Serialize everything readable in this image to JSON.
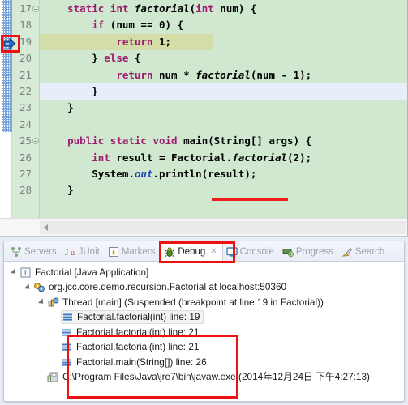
{
  "editor": {
    "bg_color": "#cfe8cc",
    "debug_line_color": "#d3dda7",
    "selected_line_color": "#e7eefa",
    "annotation_color": "#ee1c1c",
    "breakpoint_icon": "debug-current-instruction-arrow-icon",
    "lines": [
      {
        "number": "17",
        "folding": true,
        "highlight": "none",
        "text": "    static int factorial(int num) {"
      },
      {
        "number": "18",
        "folding": false,
        "highlight": "none",
        "text": "        if (num == 0) {"
      },
      {
        "number": "19",
        "folding": false,
        "highlight": "debug",
        "text": "            return 1;"
      },
      {
        "number": "20",
        "folding": false,
        "highlight": "none",
        "text": "        } else {"
      },
      {
        "number": "21",
        "folding": false,
        "highlight": "none",
        "text": "            return num * factorial(num - 1);"
      },
      {
        "number": "22",
        "folding": false,
        "highlight": "select",
        "text": "        }"
      },
      {
        "number": "23",
        "folding": false,
        "highlight": "none",
        "text": "    }"
      },
      {
        "number": "24",
        "folding": false,
        "highlight": "none",
        "text": ""
      },
      {
        "number": "25",
        "folding": true,
        "highlight": "none",
        "text": "    public static void main(String[] args) {"
      },
      {
        "number": "26",
        "folding": false,
        "highlight": "none",
        "text": "        int result = Factorial.factorial(2);"
      },
      {
        "number": "27",
        "folding": false,
        "highlight": "none",
        "text": "        System.out.println(result);"
      },
      {
        "number": "28",
        "folding": false,
        "highlight": "none",
        "text": "    }"
      }
    ]
  },
  "tabs": [
    {
      "label": "Servers",
      "icon": "servers-icon",
      "active": false,
      "closable": false
    },
    {
      "label": "JUnit",
      "icon": "junit-icon",
      "active": false,
      "closable": false
    },
    {
      "label": "Markers",
      "icon": "markers-icon",
      "active": false,
      "closable": false
    },
    {
      "label": "Debug",
      "icon": "debug-bug-icon",
      "active": true,
      "closable": true
    },
    {
      "label": "Console",
      "icon": "console-icon",
      "active": false,
      "closable": false
    },
    {
      "label": "Progress",
      "icon": "progress-icon",
      "active": false,
      "closable": false
    },
    {
      "label": "Search",
      "icon": "search-icon",
      "active": false,
      "closable": false
    }
  ],
  "tab_close_glyph": "✕",
  "debug_tree": [
    {
      "indent": 0,
      "twisty": true,
      "icon": "java-application-icon",
      "label": "Factorial [Java Application]",
      "selected": false
    },
    {
      "indent": 1,
      "twisty": true,
      "icon": "debug-target-icon",
      "label": "org.jcc.core.demo.recursion.Factorial at localhost:50360",
      "selected": false
    },
    {
      "indent": 2,
      "twisty": true,
      "icon": "thread-icon",
      "label": "Thread [main] (Suspended (breakpoint at line 19 in Factorial))",
      "selected": false
    },
    {
      "indent": 3,
      "twisty": false,
      "icon": "stack-frame-icon",
      "label": "Factorial.factorial(int) line: 19",
      "selected": true
    },
    {
      "indent": 3,
      "twisty": false,
      "icon": "stack-frame-icon",
      "label": "Factorial.factorial(int) line: 21",
      "selected": false
    },
    {
      "indent": 3,
      "twisty": false,
      "icon": "stack-frame-icon",
      "label": "Factorial.factorial(int) line: 21",
      "selected": false
    },
    {
      "indent": 3,
      "twisty": false,
      "icon": "stack-frame-icon",
      "label": "Factorial.main(String[]) line: 26",
      "selected": false
    },
    {
      "indent": 2,
      "twisty": false,
      "icon": "process-icon",
      "label": "C:\\Program Files\\Java\\jre7\\bin\\javaw.exe (2014年12月24日 下午4:27:13)",
      "selected": false
    }
  ],
  "annotations": {
    "breakpoint_box": "red-highlight-box-around-current-line-marker",
    "debug_tab_box": "red-highlight-box-around-debug-tab",
    "stack_box": "red-highlight-box-around-stack-frames",
    "factorial_underline": "red-underline-under-factorial-call"
  }
}
